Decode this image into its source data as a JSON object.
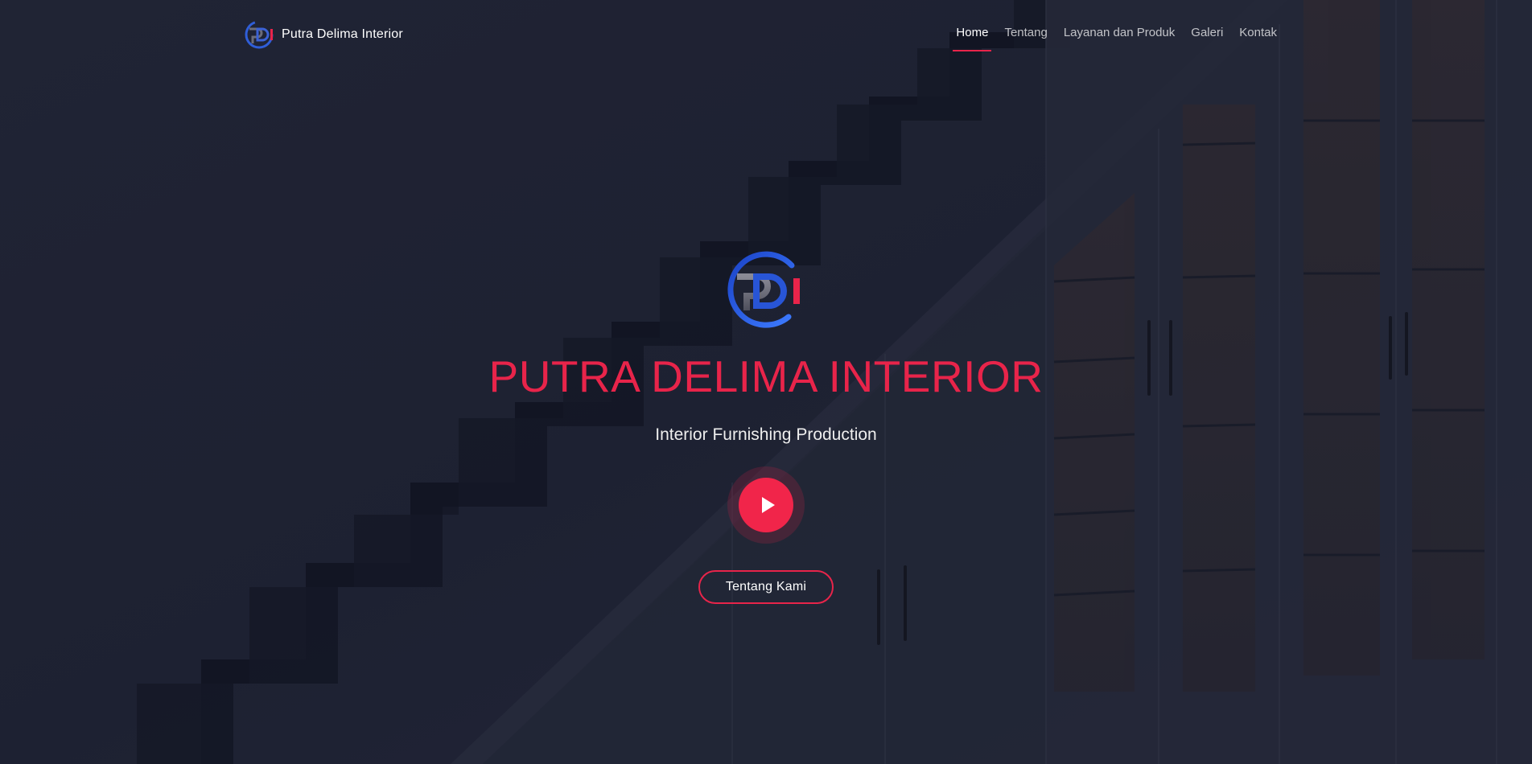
{
  "header": {
    "brand_name": "Putra Delima Interior",
    "nav": [
      {
        "label": "Home",
        "active": true
      },
      {
        "label": "Tentang",
        "active": false
      },
      {
        "label": "Layanan dan Produk",
        "active": false
      },
      {
        "label": "Galeri",
        "active": false
      },
      {
        "label": "Kontak",
        "active": false
      }
    ]
  },
  "hero": {
    "logo_text": "PDI",
    "title": "PUTRA DELIMA INTERIOR",
    "subtitle": "Interior Furnishing Production",
    "cta_label": "Tentang Kami",
    "play_icon": "play-icon",
    "background_description": "dark blue-tinted photo of staircase with built-in glass cabinets"
  },
  "colors": {
    "accent": "#e8244a",
    "overlay": "#1f2230",
    "text": "#ffffff"
  }
}
